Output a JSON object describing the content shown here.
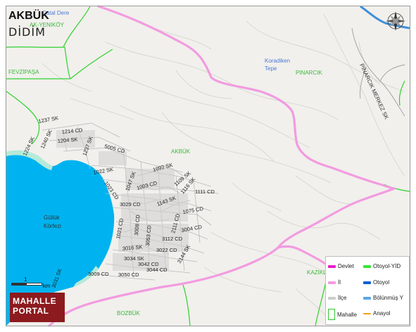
{
  "map": {
    "title": "AKBÜK",
    "subtitle": "DİDİM",
    "colors": {
      "land": "#f1f0ec",
      "sea": "#00b3f0",
      "reef": "#b6ead8",
      "village_border": "#2fd12f",
      "province_road": "#f29be0",
      "river": "#3f8fd8",
      "streets": "#b9b9b9",
      "terrain": "#d2d2cc"
    },
    "places": [
      {
        "id": "catal-dere",
        "text": "Çatal Dere",
        "color": "#4c7bd9"
      },
      {
        "id": "ak-yenikoy",
        "text": "AK-YENIKÖY",
        "color": "#3cb83c"
      },
      {
        "id": "fevzipasa",
        "text": "FEVZİPAŞA",
        "color": "#3cb83c"
      },
      {
        "id": "koradiken-tepe",
        "text": "Koradiken Tepe",
        "color": "#4c7bd9"
      },
      {
        "id": "pinarcik",
        "text": "PINARCIK",
        "color": "#3cb83c"
      },
      {
        "id": "pinarcik-merkez",
        "text": "PINARCIK MERKEZ SK",
        "color": "#333333"
      },
      {
        "id": "akbuk",
        "text": "AKBÜK",
        "color": "#3cb83c"
      },
      {
        "id": "gulluk-korfezi",
        "text": "Güllük Körfezi",
        "color": "#333333"
      },
      {
        "id": "kazikli",
        "text": "KAZIKL",
        "color": "#3cb83c"
      },
      {
        "id": "bozbuk",
        "text": "BOZBÜK",
        "color": "#3cb83c"
      }
    ],
    "streets": [
      {
        "id": "s1237",
        "text": "1237 SK"
      },
      {
        "id": "s1214",
        "text": "1214 CD"
      },
      {
        "id": "s1204",
        "text": "1204 SK"
      },
      {
        "id": "s1224",
        "text": "1224 SK"
      },
      {
        "id": "s1240",
        "text": "1240 SK"
      },
      {
        "id": "s1237b",
        "text": "1237 SK"
      },
      {
        "id": "s5005",
        "text": "5005 CD"
      },
      {
        "id": "s1022",
        "text": "1022 SK"
      },
      {
        "id": "s1092",
        "text": "1092 SK"
      },
      {
        "id": "s1023",
        "text": "1023 CD"
      },
      {
        "id": "s1003",
        "text": "1003 CD"
      },
      {
        "id": "s1047",
        "text": "1047 SK"
      },
      {
        "id": "s1109",
        "text": "1109 SK"
      },
      {
        "id": "s1116",
        "text": "1116 SK"
      },
      {
        "id": "s1111",
        "text": "1111 CD"
      },
      {
        "id": "s1143",
        "text": "1143 SK"
      },
      {
        "id": "s3029",
        "text": "3029 CD"
      },
      {
        "id": "s1075",
        "text": "1075 CD"
      },
      {
        "id": "s2111",
        "text": "2111 CD"
      },
      {
        "id": "s3004",
        "text": "3004 CD"
      },
      {
        "id": "s1021",
        "text": "1021 CD"
      },
      {
        "id": "s3008",
        "text": "3008 CD"
      },
      {
        "id": "s3053",
        "text": "3053 CD"
      },
      {
        "id": "s3112",
        "text": "3112 CD"
      },
      {
        "id": "s3016",
        "text": "3016 SK"
      },
      {
        "id": "s3022",
        "text": "3022 CD"
      },
      {
        "id": "s3034",
        "text": "3034 SK"
      },
      {
        "id": "s3042",
        "text": "3042 CD"
      },
      {
        "id": "s3144",
        "text": "3144 SK"
      },
      {
        "id": "s3044",
        "text": "3044 CD"
      },
      {
        "id": "s3009",
        "text": "3009 CD"
      },
      {
        "id": "s3050",
        "text": "3050 CD"
      },
      {
        "id": "s3031",
        "text": "3031 SK"
      }
    ],
    "scale": {
      "value": "1",
      "unit": "km"
    },
    "compass": "compass-rose-icon"
  },
  "legend": {
    "items": [
      {
        "id": "devlet",
        "label": "Devlet",
        "color": "#e81ec8",
        "kind": "line"
      },
      {
        "id": "otoyol-yid",
        "label": "Otoyol-YİD",
        "color": "#35e635",
        "kind": "line"
      },
      {
        "id": "il",
        "label": "İl",
        "color": "#f29be0",
        "kind": "line"
      },
      {
        "id": "otoyol",
        "label": "Otoyol",
        "color": "#0b5fd6",
        "kind": "line"
      },
      {
        "id": "ilce",
        "label": "İlçe",
        "color": "#cccccc",
        "kind": "line"
      },
      {
        "id": "bolunmus",
        "label": "Bölünmüş Y",
        "color": "#5aa8e6",
        "kind": "line"
      },
      {
        "id": "mahalle",
        "label": "Mahalle",
        "color": "#30c830",
        "kind": "box"
      },
      {
        "id": "anayol",
        "label": "Anayol",
        "color": "#f0a020",
        "kind": "line"
      }
    ]
  },
  "brand": {
    "line1": "MAHALLE",
    "line2": "PORTAL"
  }
}
